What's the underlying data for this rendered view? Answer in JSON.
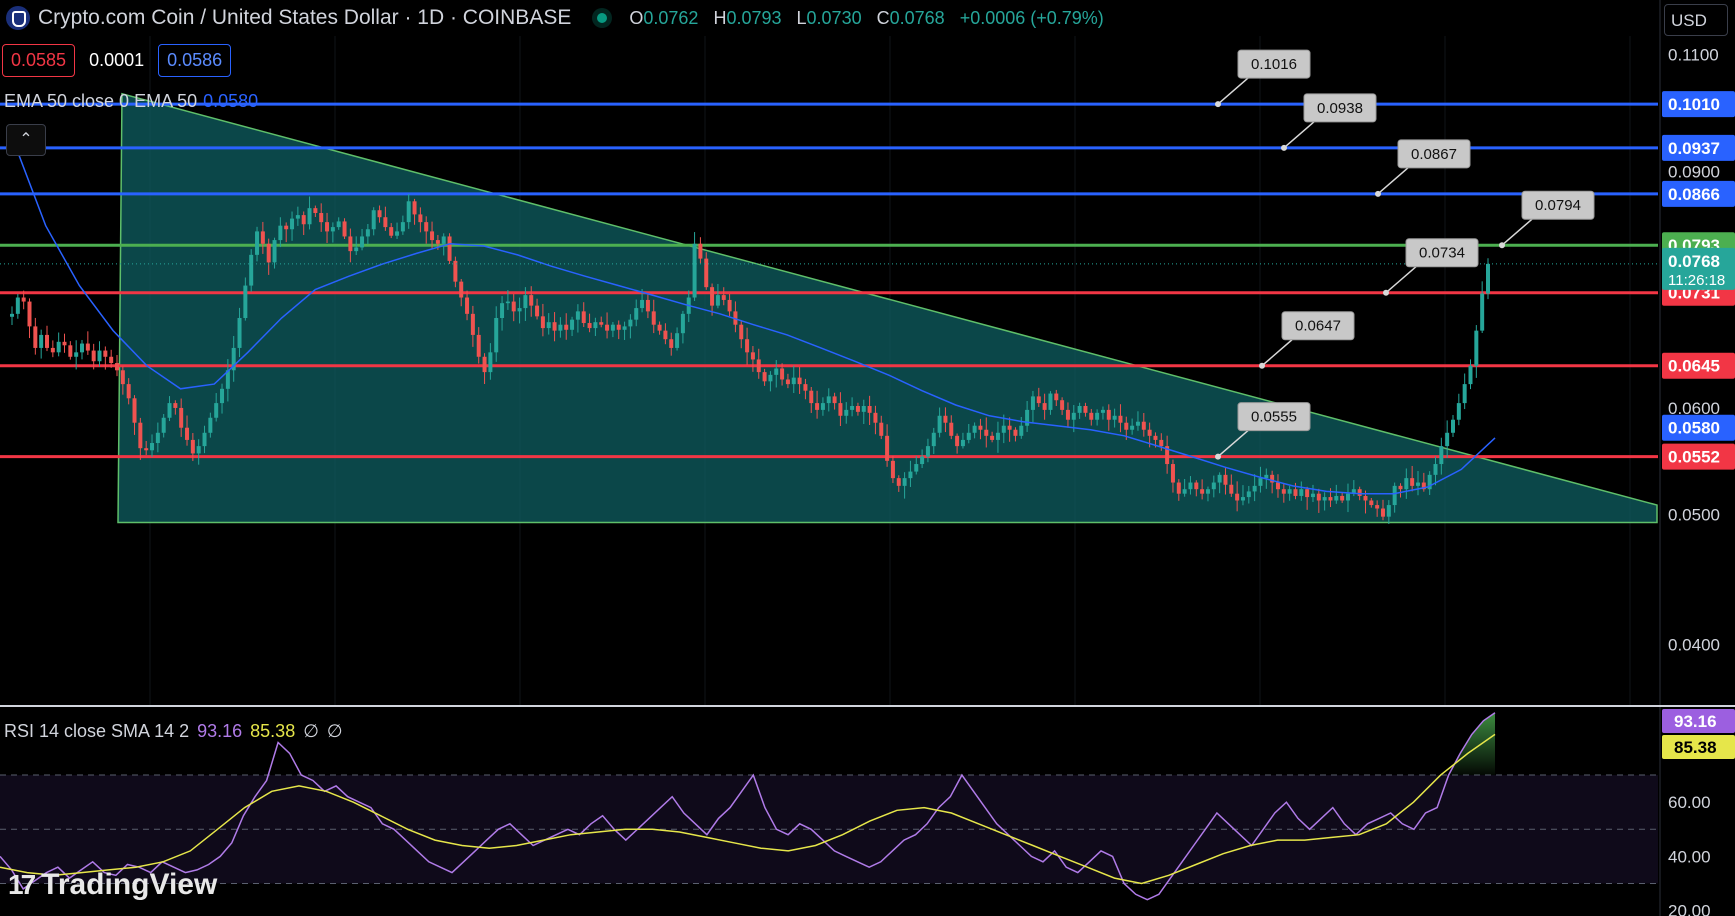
{
  "header": {
    "title": "Crypto.com Coin / United States Dollar · 1D · COINBASE",
    "ohlc": [
      {
        "k": "O",
        "v": "0.0762"
      },
      {
        "k": "H",
        "v": "0.0793"
      },
      {
        "k": "L",
        "v": "0.0730"
      },
      {
        "k": "C",
        "v": "0.0768"
      }
    ],
    "change": "+0.0006 (+0.79%)",
    "status_color": "#089981"
  },
  "quote": {
    "bid": "0.0585",
    "spread": "0.0001",
    "ask": "0.0586"
  },
  "indicators": {
    "ema_label": "EMA 50 close 0 EMA 50",
    "ema_value": "0.0580",
    "rsi_label": "RSI 14 close SMA 14 2",
    "rsi_value": "93.16",
    "rsi_sma_value": "85.38",
    "rsi_na_1": "∅",
    "rsi_na_2": "∅"
  },
  "currency": "USD",
  "brand": "TradingView",
  "collapse_glyph": "⌃",
  "colors": {
    "up": "#26a69a",
    "down": "#ef5350",
    "ema": "#2962ff",
    "resistance": "#2962ff",
    "support": "#f23645",
    "breakout": "#4caf50",
    "triangle_fill": "#0f5f61",
    "rsi": "#b07be8",
    "rsi_sma": "#e6e64a"
  },
  "chart_data": {
    "type": "candlestick",
    "price_scale": {
      "ticks": [
        "0.1100",
        "0.0900",
        "0.0600",
        "0.0500",
        "0.0400"
      ],
      "ylim": [
        0.036,
        0.1135
      ],
      "log": true
    },
    "horizontal_levels": [
      {
        "price": 0.101,
        "label": "0.1010",
        "color": "#2962ff",
        "callout": "0.1016"
      },
      {
        "price": 0.0937,
        "label": "0.0937",
        "color": "#2962ff",
        "callout": "0.0938"
      },
      {
        "price": 0.0866,
        "label": "0.0866",
        "color": "#2962ff",
        "callout": "0.0867"
      },
      {
        "price": 0.0793,
        "label": "0.0793",
        "color": "#4caf50",
        "callout": "0.0794"
      },
      {
        "price": 0.0731,
        "label": "0.0731",
        "color": "#f23645",
        "callout": "0.0734"
      },
      {
        "price": 0.0645,
        "label": "0.0645",
        "color": "#f23645",
        "callout": "0.0647"
      },
      {
        "price": 0.0552,
        "label": "0.0552",
        "color": "#f23645",
        "callout": "0.0555"
      }
    ],
    "last_price": {
      "price": "0.0768",
      "countdown": "11:26:18",
      "color": "#26a69a"
    },
    "ema_tag": {
      "price": "0.0580",
      "color": "#2962ff"
    },
    "descending_triangle": {
      "top_start": 0.1028,
      "top_end": 0.0508,
      "base": 0.0493
    },
    "price_path": [
      0.0705,
      0.0725,
      0.072,
      0.069,
      0.0665,
      0.068,
      0.0665,
      0.066,
      0.0672,
      0.0668,
      0.0655,
      0.066,
      0.067,
      0.0662,
      0.065,
      0.0662,
      0.0655,
      0.0648,
      0.064,
      0.0625,
      0.061,
      0.0585,
      0.056,
      0.0558,
      0.0565,
      0.0575,
      0.059,
      0.0605,
      0.06,
      0.058,
      0.0568,
      0.0555,
      0.0562,
      0.0575,
      0.059,
      0.0605,
      0.062,
      0.064,
      0.0665,
      0.07,
      0.074,
      0.078,
      0.0812,
      0.0795,
      0.077,
      0.08,
      0.082,
      0.0815,
      0.083,
      0.0835,
      0.0822,
      0.0845,
      0.0838,
      0.0825,
      0.0812,
      0.0818,
      0.0826,
      0.0805,
      0.0785,
      0.079,
      0.0805,
      0.0815,
      0.0842,
      0.0832,
      0.0818,
      0.0806,
      0.0812,
      0.0825,
      0.0855,
      0.0836,
      0.0825,
      0.0812,
      0.08,
      0.0795,
      0.0805,
      0.0772,
      0.0745,
      0.0725,
      0.0705,
      0.068,
      0.0655,
      0.0638,
      0.066,
      0.07,
      0.0718,
      0.072,
      0.0708,
      0.0712,
      0.0728,
      0.0715,
      0.0702,
      0.0688,
      0.0695,
      0.0685,
      0.0692,
      0.0686,
      0.0698,
      0.0708,
      0.0694,
      0.0688,
      0.0695,
      0.0692,
      0.0685,
      0.0692,
      0.0686,
      0.069,
      0.0698,
      0.0712,
      0.0722,
      0.0708,
      0.0692,
      0.0685,
      0.0675,
      0.0665,
      0.0682,
      0.0705,
      0.0725,
      0.0795,
      0.0775,
      0.0738,
      0.0715,
      0.0728,
      0.0722,
      0.0708,
      0.0692,
      0.0675,
      0.066,
      0.0652,
      0.0638,
      0.0628,
      0.0635,
      0.0642,
      0.063,
      0.0625,
      0.0632,
      0.0625,
      0.0618,
      0.0605,
      0.0598,
      0.0605,
      0.0612,
      0.0605,
      0.0592,
      0.0598,
      0.0602,
      0.0596,
      0.0602,
      0.0595,
      0.0585,
      0.0572,
      0.0548,
      0.0532,
      0.0525,
      0.0532,
      0.0538,
      0.0545,
      0.0552,
      0.0562,
      0.0575,
      0.0592,
      0.0585,
      0.0572,
      0.0562,
      0.0568,
      0.0575,
      0.0582,
      0.0578,
      0.0572,
      0.0568,
      0.0575,
      0.0582,
      0.0578,
      0.0572,
      0.0582,
      0.0598,
      0.0612,
      0.0605,
      0.0598,
      0.0615,
      0.0608,
      0.0598,
      0.0588,
      0.0595,
      0.0602,
      0.0595,
      0.0588,
      0.0595,
      0.0598,
      0.0588,
      0.0592,
      0.0585,
      0.0578,
      0.0582,
      0.0586,
      0.0578,
      0.0572,
      0.0568,
      0.0562,
      0.0545,
      0.0528,
      0.0518,
      0.0522,
      0.0528,
      0.0522,
      0.0518,
      0.0522,
      0.0528,
      0.0535,
      0.0526,
      0.0518,
      0.0512,
      0.0515,
      0.052,
      0.0525,
      0.0532,
      0.0535,
      0.0528,
      0.0522,
      0.0518,
      0.0522,
      0.0516,
      0.0522,
      0.0515,
      0.0518,
      0.0512,
      0.0515,
      0.0512,
      0.0516,
      0.0512,
      0.0518,
      0.0522,
      0.0516,
      0.0512,
      0.0508,
      0.0505,
      0.0498,
      0.0508,
      0.0525,
      0.0522,
      0.0532,
      0.0525,
      0.0528,
      0.0522,
      0.0535,
      0.0545,
      0.0562,
      0.0575,
      0.0588,
      0.0605,
      0.0625,
      0.0645,
      0.0685,
      0.073,
      0.0768
    ],
    "ema_path": [
      0.0955,
      0.082,
      0.074,
      0.0685,
      0.0645,
      0.062,
      0.0625,
      0.066,
      0.07,
      0.0735,
      0.0752,
      0.0768,
      0.0782,
      0.0795,
      0.0792,
      0.078,
      0.0765,
      0.0752,
      0.074,
      0.0728,
      0.0716,
      0.0705,
      0.0692,
      0.068,
      0.0665,
      0.065,
      0.0635,
      0.0618,
      0.0603,
      0.0592,
      0.0586,
      0.0582,
      0.0578,
      0.0572,
      0.0562,
      0.0552,
      0.0542,
      0.0533,
      0.0525,
      0.052,
      0.0518,
      0.0518,
      0.0524,
      0.054,
      0.057
    ],
    "rsi": {
      "axis_ticks": [
        "60.00",
        "40.00",
        "20.00"
      ],
      "ylim": [
        18,
        94
      ],
      "bands": [
        30,
        50,
        70
      ]
    },
    "rsi_path": [
      40,
      35,
      28,
      31,
      34,
      36,
      32,
      35,
      38,
      34,
      33,
      37,
      36,
      34,
      38,
      36,
      34,
      35,
      37,
      40,
      45,
      55,
      62,
      68,
      82,
      78,
      70,
      68,
      64,
      66,
      62,
      60,
      58,
      52,
      50,
      46,
      42,
      38,
      36,
      34,
      38,
      42,
      46,
      50,
      52,
      48,
      44,
      46,
      48,
      50,
      48,
      52,
      55,
      50,
      46,
      50,
      54,
      58,
      62,
      56,
      52,
      48,
      54,
      58,
      64,
      70,
      58,
      50,
      48,
      52,
      50,
      46,
      42,
      40,
      38,
      36,
      38,
      42,
      46,
      48,
      52,
      58,
      62,
      70,
      64,
      58,
      52,
      48,
      44,
      40,
      38,
      42,
      36,
      34,
      38,
      42,
      40,
      30,
      26,
      24,
      26,
      32,
      38,
      44,
      50,
      56,
      52,
      48,
      44,
      50,
      56,
      60,
      54,
      50,
      54,
      58,
      52,
      48,
      52,
      54,
      56,
      52,
      50,
      56,
      58,
      70,
      78,
      85,
      90,
      93
    ],
    "rsi_sma_path": [
      36,
      34,
      33,
      34,
      35,
      36,
      38,
      42,
      50,
      58,
      64,
      66,
      64,
      60,
      55,
      50,
      46,
      44,
      43,
      44,
      46,
      48,
      49,
      50,
      50,
      49,
      47,
      45,
      43,
      42,
      44,
      48,
      53,
      57,
      58,
      56,
      52,
      48,
      44,
      40,
      36,
      32,
      30,
      33,
      37,
      41,
      44,
      46,
      46,
      47,
      48,
      52,
      60,
      70,
      78,
      85
    ],
    "rsi_bubbles": [
      {
        "value": "93.16",
        "color": "#9c5fe0",
        "text": "#ffffff"
      },
      {
        "value": "85.38",
        "color": "#e6e64a",
        "text": "#000000"
      }
    ]
  }
}
